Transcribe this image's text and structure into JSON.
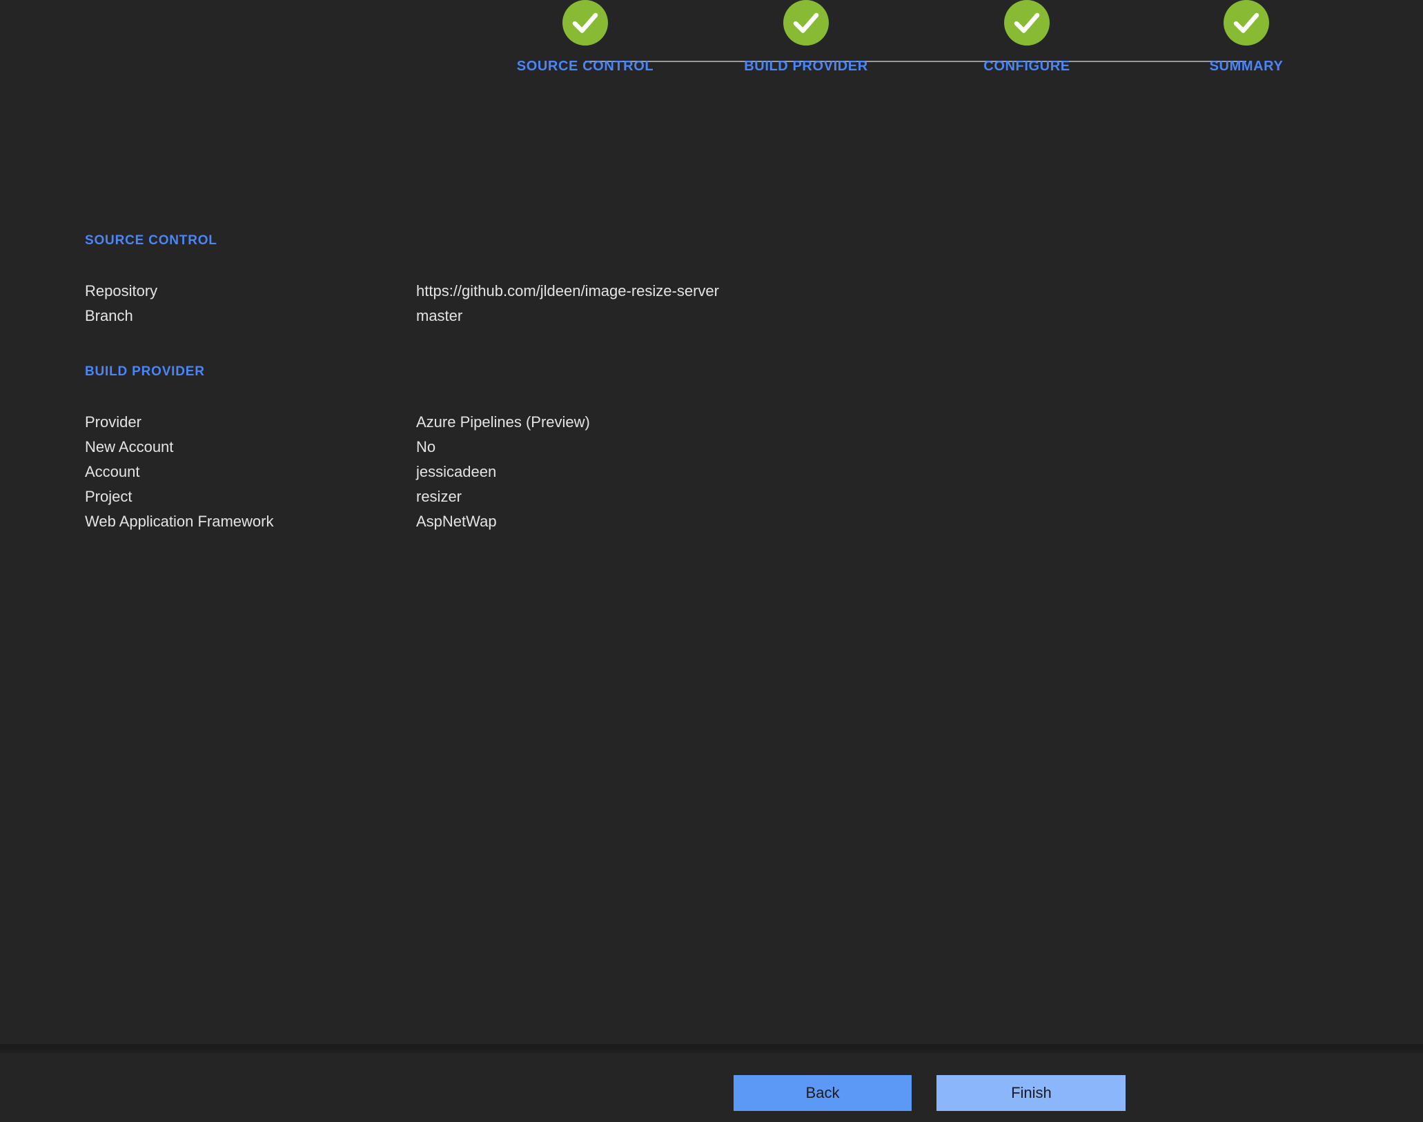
{
  "theme": {
    "background": "#252525",
    "accent_blue": "#4a86f7",
    "step_complete_green": "#88bb33",
    "text": "#e4e4e4",
    "connector_line": "#9a9aa0"
  },
  "stepper": {
    "steps": [
      {
        "label": "SOURCE CONTROL",
        "state": "complete",
        "icon": "check-icon"
      },
      {
        "label": "BUILD PROVIDER",
        "state": "complete",
        "icon": "check-icon"
      },
      {
        "label": "CONFIGURE",
        "state": "complete",
        "icon": "check-icon"
      },
      {
        "label": "SUMMARY",
        "state": "complete",
        "icon": "check-icon"
      }
    ]
  },
  "summary": {
    "sections": [
      {
        "title": "SOURCE CONTROL",
        "rows": [
          {
            "key": "Repository",
            "value": "https://github.com/jldeen/image-resize-server"
          },
          {
            "key": "Branch",
            "value": "master"
          }
        ]
      },
      {
        "title": "BUILD PROVIDER",
        "rows": [
          {
            "key": "Provider",
            "value": "Azure Pipelines (Preview)"
          },
          {
            "key": "New Account",
            "value": "No"
          },
          {
            "key": "Account",
            "value": "jessicadeen"
          },
          {
            "key": "Project",
            "value": "resizer"
          },
          {
            "key": "Web Application Framework",
            "value": "AspNetWap"
          }
        ]
      }
    ]
  },
  "footer": {
    "back_label": "Back",
    "finish_label": "Finish"
  }
}
